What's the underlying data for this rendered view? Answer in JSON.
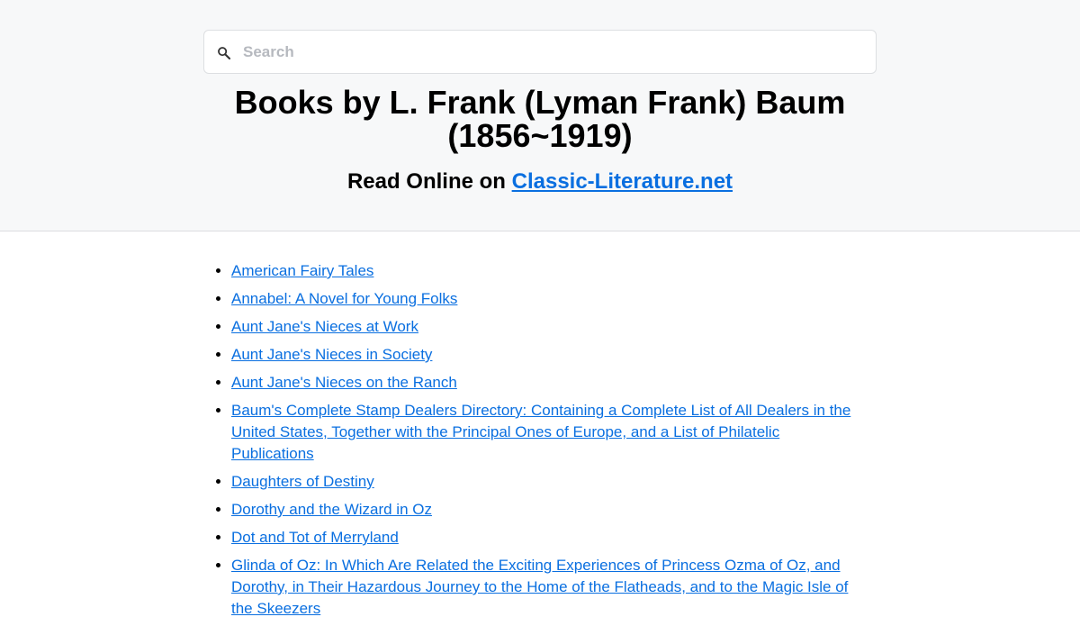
{
  "search": {
    "placeholder": "Search"
  },
  "header": {
    "title": "Books by L. Frank (Lyman Frank) Baum (1856~1919)",
    "subtitle_prefix": "Read Online on ",
    "site_link": "Classic-Literature.net"
  },
  "books": [
    "American Fairy Tales",
    "Annabel: A Novel for Young Folks",
    "Aunt Jane's Nieces at Work",
    "Aunt Jane's Nieces in Society",
    "Aunt Jane's Nieces on the Ranch",
    "Baum's Complete Stamp Dealers Directory: Containing a Complete List of All Dealers in the United States, Together with the Principal Ones of Europe, and a List of Philatelic Publications",
    "Daughters of Destiny",
    "Dorothy and the Wizard in Oz",
    "Dot and Tot of Merryland",
    "Glinda of Oz: In Which Are Related the Exciting Experiences of Princess Ozma of Oz, and Dorothy, in Their Hazardous Journey to the Home of the Flatheads, and to the Magic Isle of the Skeezers"
  ],
  "colors": {
    "link": "#0a6fe0",
    "header_bg": "#f7f8f9"
  }
}
